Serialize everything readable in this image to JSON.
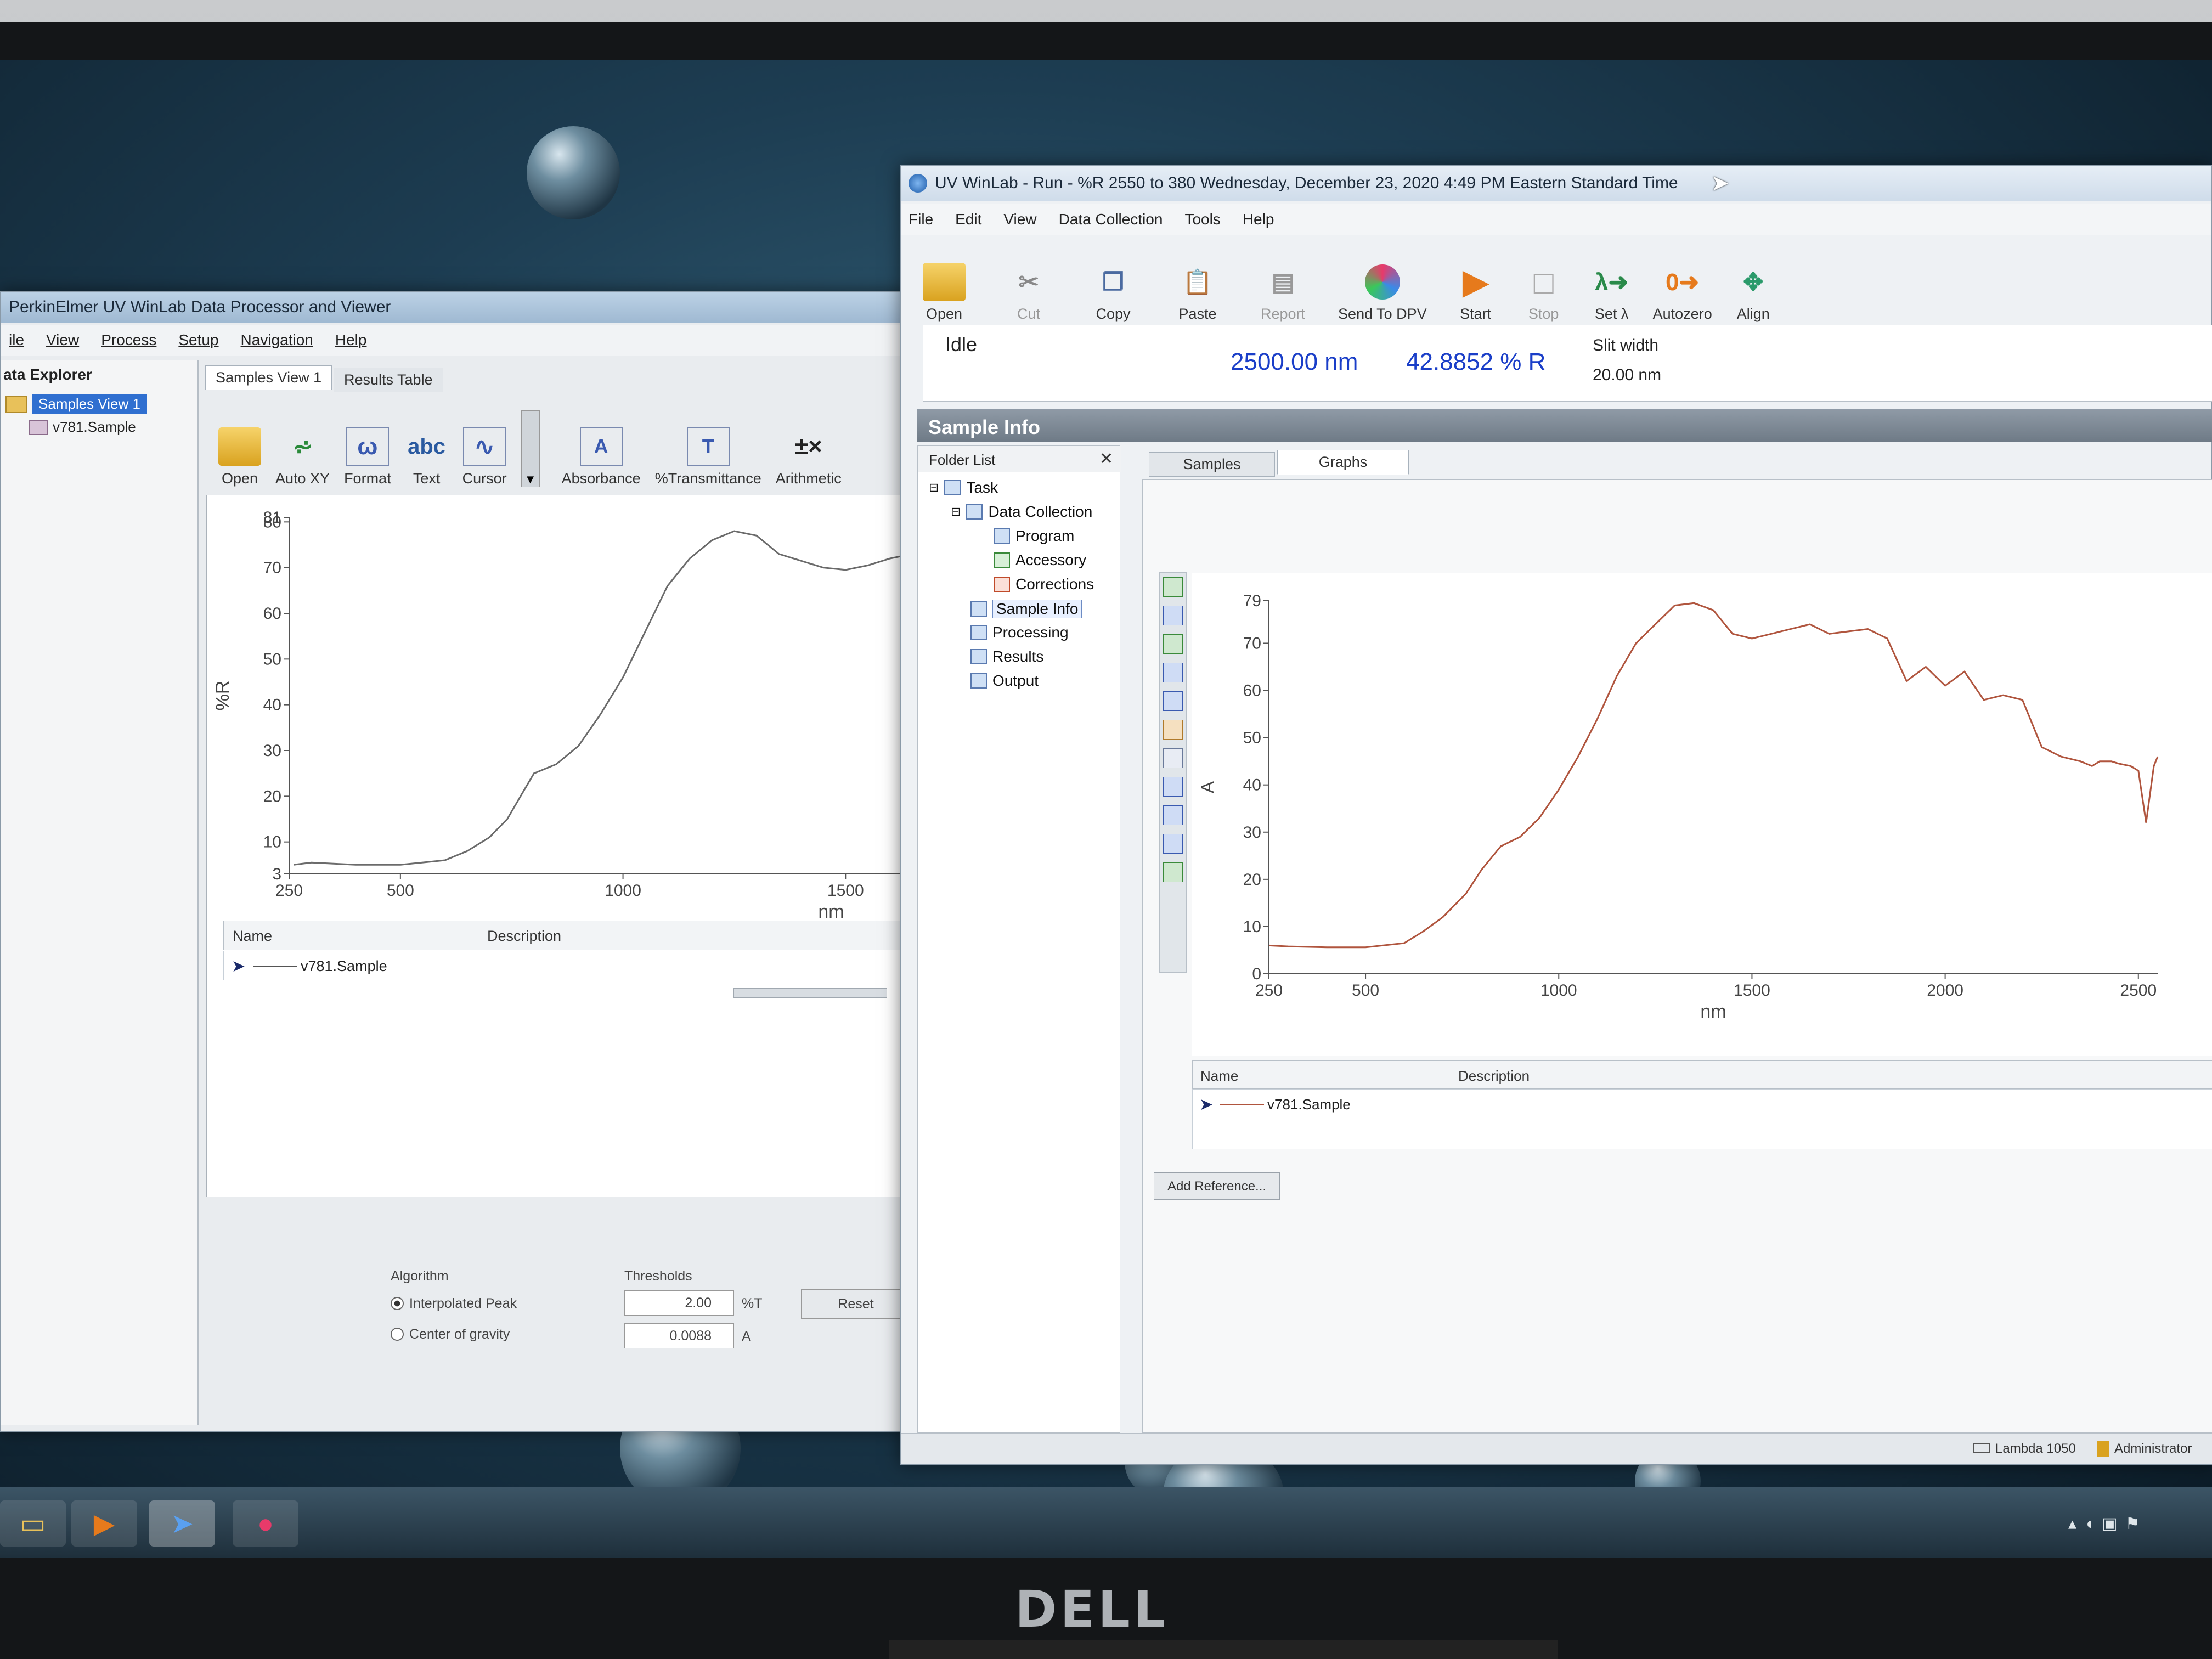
{
  "monitor": {
    "brand": "DELL"
  },
  "left_window": {
    "title": "PerkinElmer UV WinLab Data Processor and Viewer",
    "menu": [
      "ile",
      "View",
      "Process",
      "Setup",
      "Navigation",
      "Help"
    ],
    "explorer_title": "ata Explorer",
    "explorer_items": [
      "Samples View 1",
      "v781.Sample"
    ],
    "tabs": [
      "Samples View 1",
      "Results Table"
    ],
    "toolbar": [
      "Open",
      "Auto XY",
      "Format",
      "Text",
      "Cursor",
      "Absorbance",
      "%Transmittance",
      "Arithmetic"
    ],
    "graph": {
      "y_label": "%R",
      "x_label": "nm",
      "y_top": "81",
      "y_bottom": "3"
    },
    "list_headers": [
      "Name",
      "Description"
    ],
    "list_row": "v781.Sample",
    "peak": {
      "algorithm_label": "Algorithm",
      "thresholds_label": "Thresholds",
      "opt1": "Interpolated Peak",
      "opt2": "Center of gravity",
      "val1": "2.00",
      "unit1": "%T",
      "val2": "0.0088",
      "unit2": "A",
      "reset": "Reset"
    }
  },
  "right_window": {
    "title": "UV WinLab - Run - %R 2550 to 380 Wednesday, December 23, 2020 4:49 PM Eastern Standard Time",
    "menu": [
      "File",
      "Edit",
      "View",
      "Data Collection",
      "Tools",
      "Help"
    ],
    "toolbar": [
      "Open",
      "Cut",
      "Copy",
      "Paste",
      "Report",
      "Send To DPV",
      "Start",
      "Stop",
      "Set λ",
      "Autozero",
      "Align"
    ],
    "status": {
      "state": "Idle",
      "wavelength": "2500.00 nm",
      "reading": "42.8852 % R",
      "slit_label": "Slit width",
      "slit_value": "20.00 nm"
    },
    "section_title": "Sample Info",
    "folder_list_title": "Folder List",
    "tree": [
      "Task",
      "Data Collection",
      "Program",
      "Accessory",
      "Corrections",
      "Sample Info",
      "Processing",
      "Results",
      "Output"
    ],
    "tabs": [
      "Samples",
      "Graphs"
    ],
    "graph": {
      "y_label": "A",
      "x_label": "nm",
      "y_top": "79"
    },
    "list_headers": [
      "Name",
      "Description"
    ],
    "list_row": "v781.Sample",
    "add_reference": "Add Reference...",
    "statusbar": [
      "Lambda 1050",
      "Administrator"
    ]
  },
  "chart_data": [
    {
      "type": "line",
      "xlabel": "nm",
      "ylabel": "%R",
      "xlim": [
        250,
        1650
      ],
      "ylim": [
        3,
        81
      ],
      "x_ticks": [
        "250",
        "500",
        "1000",
        "1500"
      ],
      "y_ticks": [
        "3",
        "10",
        "20",
        "30",
        "40",
        "50",
        "60",
        "70",
        "80",
        "81"
      ],
      "series": [
        {
          "name": "v781.Sample",
          "color": "#6b6b6b",
          "x": [
            260,
            300,
            400,
            500,
            600,
            650,
            700,
            740,
            770,
            800,
            850,
            900,
            950,
            1000,
            1050,
            1100,
            1150,
            1200,
            1250,
            1300,
            1350,
            1400,
            1450,
            1500,
            1550,
            1600,
            1650
          ],
          "y": [
            5,
            5.5,
            5,
            5,
            6,
            8,
            11,
            15,
            20,
            25,
            27,
            31,
            38,
            46,
            56,
            66,
            72,
            76,
            78,
            77,
            73,
            71.5,
            70,
            69.5,
            70.5,
            72,
            73
          ]
        }
      ]
    },
    {
      "type": "line",
      "xlabel": "nm",
      "ylabel": "A",
      "xlim": [
        250,
        2550
      ],
      "ylim": [
        0,
        79
      ],
      "x_ticks": [
        "250",
        "500",
        "1000",
        "1500",
        "2000",
        "2500"
      ],
      "y_ticks": [
        "0",
        "10",
        "20",
        "30",
        "40",
        "50",
        "60",
        "70",
        "79"
      ],
      "series": [
        {
          "name": "v781.Sample",
          "color": "#b0553e",
          "x": [
            250,
            300,
            400,
            500,
            600,
            650,
            700,
            760,
            800,
            850,
            900,
            950,
            1000,
            1050,
            1100,
            1150,
            1200,
            1250,
            1300,
            1350,
            1400,
            1450,
            1500,
            1550,
            1600,
            1650,
            1700,
            1750,
            1800,
            1850,
            1900,
            1950,
            2000,
            2050,
            2100,
            2150,
            2200,
            2250,
            2300,
            2350,
            2380,
            2400,
            2430,
            2450,
            2480,
            2500,
            2520,
            2540,
            2550
          ],
          "y": [
            6,
            5.8,
            5.6,
            5.6,
            6.5,
            9,
            12,
            17,
            22,
            27,
            29,
            33,
            39,
            46,
            54,
            63,
            70,
            74,
            78,
            78.5,
            77,
            72,
            71,
            72,
            73,
            74,
            72,
            72.5,
            73,
            71,
            62,
            65,
            61,
            64,
            58,
            59,
            58,
            48,
            46,
            45,
            44,
            45,
            45,
            44.5,
            44,
            43,
            32,
            44,
            46
          ]
        }
      ]
    }
  ]
}
